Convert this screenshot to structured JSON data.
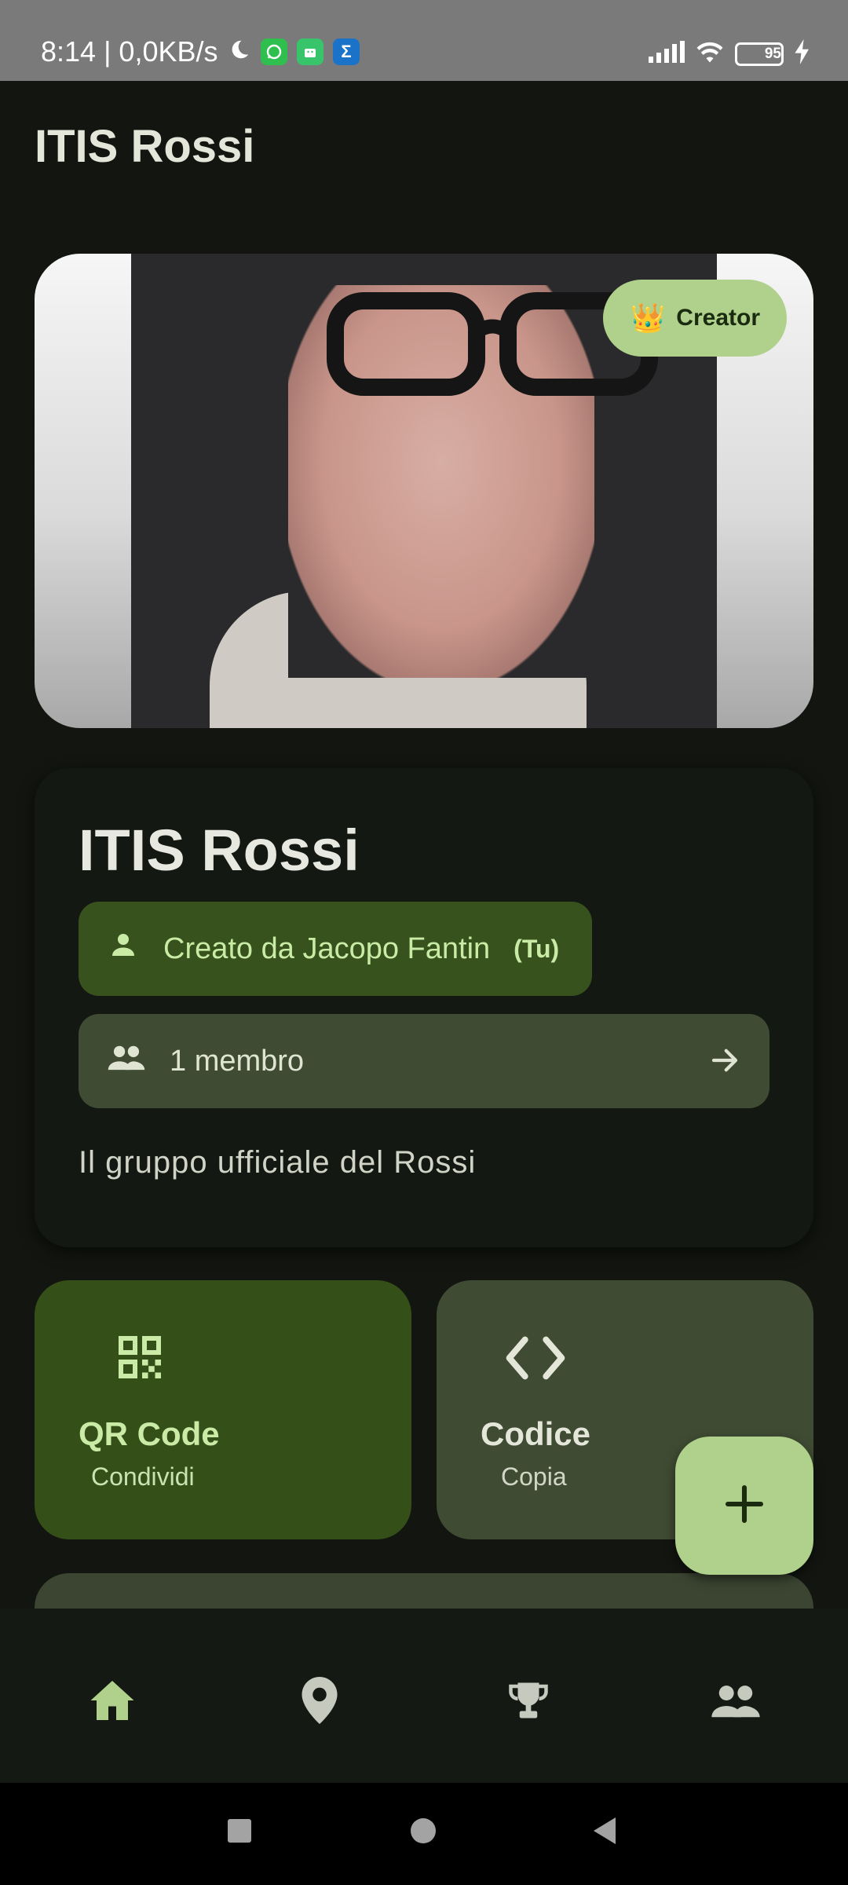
{
  "status_bar": {
    "time": "8:14 | 0,0KB/s",
    "battery": "95",
    "app_icons": [
      "whatsapp-icon",
      "android-app-icon",
      "sigma-icon"
    ]
  },
  "app_bar": {
    "title": "ITIS Rossi"
  },
  "hero": {
    "badge_label": "Creator",
    "badge_emoji": "👑"
  },
  "group": {
    "name": "ITIS Rossi",
    "creator_label": "Creato da Jacopo Fantin",
    "creator_suffix": "(Tu)",
    "members_label": "1 membro",
    "description": "Il gruppo ufficiale del Rossi"
  },
  "actions": {
    "qr": {
      "title": "QR Code",
      "subtitle": "Condividi"
    },
    "code": {
      "title": "Codice",
      "subtitle": "Copia"
    }
  },
  "fab": {
    "icon": "plus-icon"
  },
  "bottom_nav": {
    "items": [
      {
        "icon": "home-icon",
        "active": true
      },
      {
        "icon": "location-pin-icon",
        "active": false
      },
      {
        "icon": "trophy-icon",
        "active": false
      },
      {
        "icon": "group-icon",
        "active": false
      }
    ]
  },
  "colors": {
    "background": "#121510",
    "accent": "#b0d18c",
    "chip_dark_green": "#38521e",
    "chip_olive": "#3f4b33",
    "tile_green": "#344f17"
  }
}
